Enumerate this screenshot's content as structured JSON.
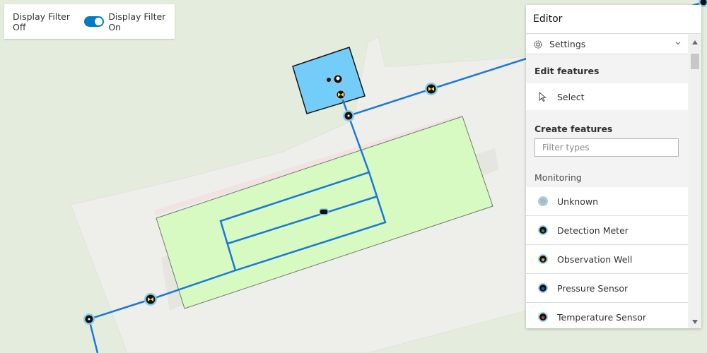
{
  "display_filter": {
    "off_label": "Display Filter Off",
    "on_label": "Display Filter On",
    "state": "on"
  },
  "editor": {
    "title": "Editor",
    "settings_label": "Settings",
    "edit_features": {
      "title": "Edit features",
      "select_label": "Select"
    },
    "create_features": {
      "title": "Create features",
      "filter_placeholder": "Filter types",
      "group": "Monitoring",
      "types": [
        {
          "label": "Unknown",
          "icon": "unknown-sensor-icon",
          "color": "#b8b8b8"
        },
        {
          "label": "Detection Meter",
          "icon": "detection-meter-icon",
          "color": "#2d8c48"
        },
        {
          "label": "Observation Well",
          "icon": "observation-well-icon",
          "color": "#d8a21e"
        },
        {
          "label": "Pressure Sensor",
          "icon": "pressure-sensor-icon",
          "color": "#2f4fb0"
        },
        {
          "label": "Temperature Sensor",
          "icon": "temperature-sensor-icon",
          "color": "#c44024"
        }
      ]
    }
  },
  "colors": {
    "accent": "#007ac2",
    "pipe": "#1a78d8",
    "building_fill": "#73cdf8",
    "field_fill": "#d6fac2",
    "map_background": "#e4eddd"
  }
}
